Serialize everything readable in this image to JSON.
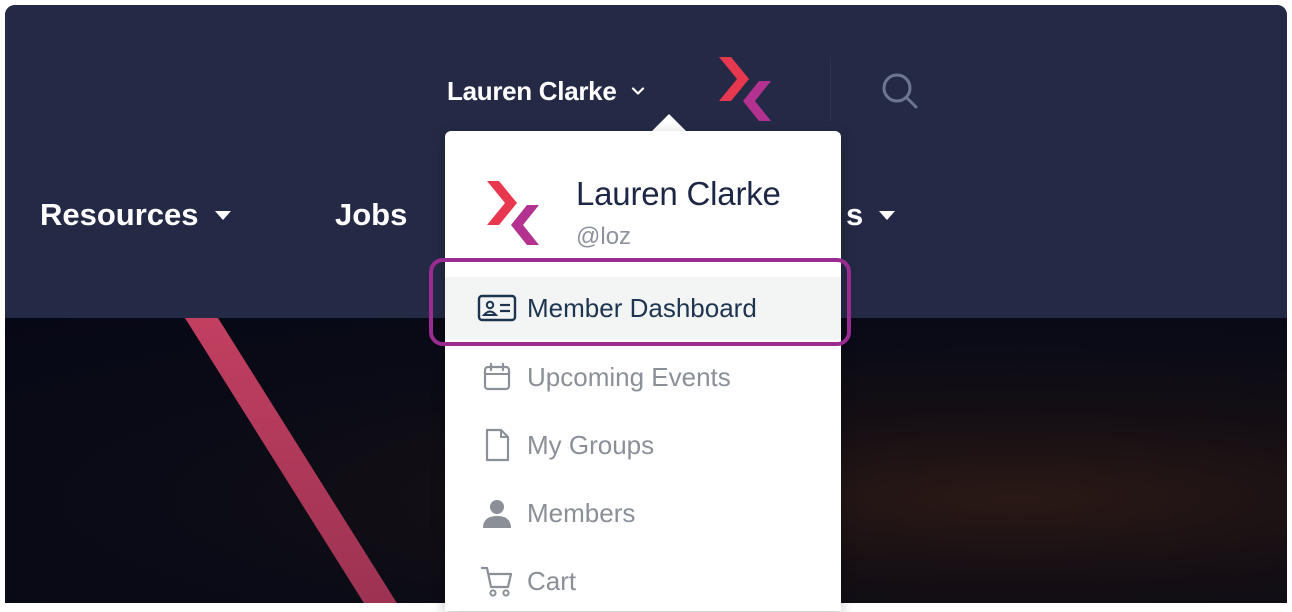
{
  "header": {
    "user_name": "Lauren Clarke"
  },
  "nav": {
    "items": [
      {
        "label": "Resources",
        "has_caret": true
      },
      {
        "label": "Jobs",
        "has_caret": false
      },
      {
        "label": "s",
        "has_caret": true
      }
    ]
  },
  "dropdown": {
    "name": "Lauren Clarke",
    "handle": "@loz",
    "items": [
      {
        "label": "Member Dashboard",
        "icon": "id-card-icon",
        "active": true
      },
      {
        "label": "Upcoming Events",
        "icon": "calendar-icon",
        "active": false
      },
      {
        "label": "My Groups",
        "icon": "document-icon",
        "active": false
      },
      {
        "label": "Members",
        "icon": "person-icon",
        "active": false
      },
      {
        "label": "Cart",
        "icon": "cart-icon",
        "active": false
      }
    ]
  },
  "colors": {
    "header_bg": "#242a45",
    "highlight": "#9b2b90",
    "brand_red": "#e8384f",
    "brand_magenta": "#b3318f",
    "active_text": "#1d3550"
  }
}
